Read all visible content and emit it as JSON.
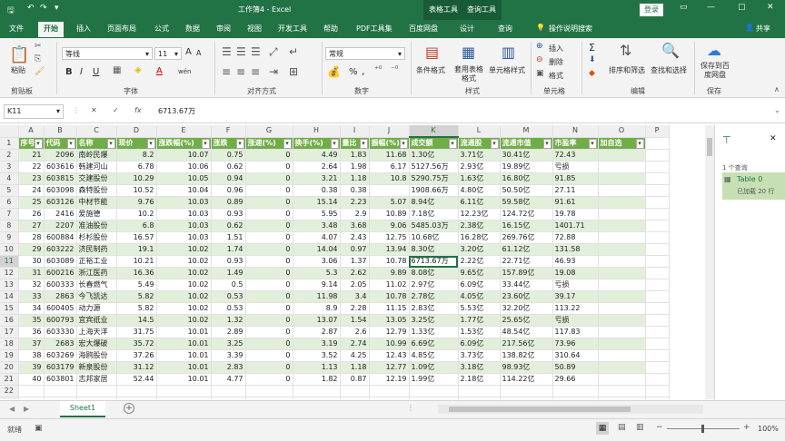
{
  "titlebar": {
    "title": "工作簿4 - Excel",
    "ctx_table": "表格工具",
    "ctx_query": "查询工具",
    "login": "登录",
    "minimize": "—",
    "restore": "▢",
    "close": "✕",
    "qa_save": "🖫",
    "qa_undo": "↶",
    "qa_redo": "↷",
    "qa_more": "▾"
  },
  "tabs": [
    "文件",
    "开始",
    "插入",
    "页面布局",
    "公式",
    "数据",
    "审阅",
    "视图",
    "开发工具",
    "帮助",
    "PDF工具集",
    "百度网盘",
    "设计",
    "查询"
  ],
  "tell_me": "操作说明搜索",
  "share": "共享",
  "ribbon": {
    "paste": "粘贴",
    "clipboard": "剪贴板",
    "font_name": "等线",
    "font_size": "11",
    "font_group": "字体",
    "bold": "B",
    "italic": "I",
    "underline": "U",
    "grow": "A",
    "shrink": "A",
    "font_color": "A",
    "wen": "wén",
    "align_group": "对齐方式",
    "number_format": "常规",
    "number_group": "数字",
    "pct": "%",
    "comma": ",",
    "cond_format": "条件格式",
    "table_format": "套用表格格式",
    "cell_styles": "单元格样式",
    "style_group": "样式",
    "insert": "插入",
    "delete": "删除",
    "format": "格式",
    "cells_group": "单元格",
    "sort_filter": "排序和筛选",
    "find_select": "查找和选择",
    "edit_group": "编辑",
    "save_baidu": "保存到百度网盘",
    "save_group": "保存"
  },
  "formula": {
    "name_box": "K11",
    "cancel": "✕",
    "confirm": "✓",
    "fx": "fx",
    "value": "6713.67万"
  },
  "columns": [
    "A",
    "B",
    "C",
    "D",
    "E",
    "F",
    "G",
    "H",
    "I",
    "J",
    "K",
    "L",
    "M",
    "N",
    "O",
    "P"
  ],
  "header_row": [
    "序号",
    "代码",
    "名称",
    "现价",
    "涨跌幅(%)",
    "涨跌",
    "涨速(%)",
    "换手(%)",
    "量比",
    "振幅(%)",
    "成交额",
    "流通股",
    "流通市值",
    "市盈率",
    "加自选"
  ],
  "rows": [
    [
      "21",
      "2096",
      "南岭民爆",
      "8.2",
      "10.07",
      "0.75",
      "0",
      "4.49",
      "1.83",
      "11.68",
      "1.30亿",
      "3.71亿",
      "30.41亿",
      "72.43",
      ""
    ],
    [
      "22",
      "603616",
      "韩建河山",
      "6.78",
      "10.06",
      "0.62",
      "0",
      "2.64",
      "1.98",
      "6.17",
      "5127.56万",
      "2.93亿",
      "19.89亿",
      "亏损",
      ""
    ],
    [
      "23",
      "603815",
      "交建股份",
      "10.29",
      "10.05",
      "0.94",
      "0",
      "3.21",
      "1.18",
      "10.8",
      "5290.75万",
      "1.63亿",
      "16.80亿",
      "91.85",
      ""
    ],
    [
      "24",
      "603098",
      "森特股份",
      "10.52",
      "10.04",
      "0.96",
      "0",
      "0.38",
      "0.38",
      "",
      "1908.66万",
      "4.80亿",
      "50.50亿",
      "27.11",
      ""
    ],
    [
      "25",
      "603126",
      "中材节能",
      "9.76",
      "10.03",
      "0.89",
      "0",
      "15.14",
      "2.23",
      "5.07",
      "8.94亿",
      "6.11亿",
      "59.58亿",
      "91.61",
      ""
    ],
    [
      "26",
      "2416",
      "爱施德",
      "10.2",
      "10.03",
      "0.93",
      "0",
      "5.95",
      "2.9",
      "10.89",
      "7.18亿",
      "12.23亿",
      "124.72亿",
      "19.78",
      ""
    ],
    [
      "27",
      "2207",
      "准油股份",
      "6.8",
      "10.03",
      "0.62",
      "0",
      "3.48",
      "3.68",
      "9.06",
      "5485.03万",
      "2.38亿",
      "16.15亿",
      "1401.71",
      ""
    ],
    [
      "28",
      "600884",
      "杉杉股份",
      "16.57",
      "10.03",
      "1.51",
      "0",
      "4.07",
      "2.43",
      "12.75",
      "10.68亿",
      "16.28亿",
      "269.76亿",
      "72.88",
      ""
    ],
    [
      "29",
      "603222",
      "济民制药",
      "19.1",
      "10.02",
      "1.74",
      "0",
      "14.04",
      "0.97",
      "13.94",
      "8.30亿",
      "3.20亿",
      "61.12亿",
      "131.58",
      ""
    ],
    [
      "30",
      "603089",
      "正裕工业",
      "10.21",
      "10.02",
      "0.93",
      "0",
      "3.06",
      "1.37",
      "10.78",
      "6713.67万",
      "2.22亿",
      "22.71亿",
      "46.93",
      ""
    ],
    [
      "31",
      "600216",
      "浙江医药",
      "16.36",
      "10.02",
      "1.49",
      "0",
      "5.3",
      "2.62",
      "9.89",
      "8.08亿",
      "9.65亿",
      "157.89亿",
      "19.08",
      ""
    ],
    [
      "32",
      "600333",
      "长春燃气",
      "5.49",
      "10.02",
      "0.5",
      "0",
      "9.14",
      "2.05",
      "11.02",
      "2.97亿",
      "6.09亿",
      "33.44亿",
      "亏损",
      ""
    ],
    [
      "33",
      "2863",
      "今飞凯达",
      "5.82",
      "10.02",
      "0.53",
      "0",
      "11.98",
      "3.4",
      "10.78",
      "2.78亿",
      "4.05亿",
      "23.60亿",
      "39.17",
      ""
    ],
    [
      "34",
      "600405",
      "动力源",
      "5.82",
      "10.02",
      "0.53",
      "0",
      "8.9",
      "2.28",
      "11.15",
      "2.83亿",
      "5.53亿",
      "32.20亿",
      "113.22",
      ""
    ],
    [
      "35",
      "600793",
      "宜宾纸业",
      "14.5",
      "10.02",
      "1.32",
      "0",
      "13.07",
      "1.54",
      "13.05",
      "3.25亿",
      "1.77亿",
      "25.65亿",
      "亏损",
      ""
    ],
    [
      "36",
      "603330",
      "上海天洋",
      "31.75",
      "10.01",
      "2.89",
      "0",
      "2.87",
      "2.6",
      "12.79",
      "1.33亿",
      "1.53亿",
      "48.54亿",
      "117.83",
      ""
    ],
    [
      "37",
      "2683",
      "宏大爆破",
      "35.72",
      "10.01",
      "3.25",
      "0",
      "3.19",
      "2.74",
      "10.99",
      "6.69亿",
      "6.09亿",
      "217.56亿",
      "73.96",
      ""
    ],
    [
      "38",
      "603269",
      "海鸥股份",
      "37.26",
      "10.01",
      "3.39",
      "0",
      "3.52",
      "4.25",
      "12.43",
      "4.85亿",
      "3.73亿",
      "138.82亿",
      "310.64",
      ""
    ],
    [
      "39",
      "603179",
      "新泉股份",
      "31.12",
      "10.01",
      "2.83",
      "0",
      "1.13",
      "1.18",
      "12.77",
      "1.09亿",
      "3.18亿",
      "98.93亿",
      "50.89",
      ""
    ],
    [
      "40",
      "603801",
      "志邦家居",
      "52.44",
      "10.01",
      "4.77",
      "0",
      "1.82",
      "0.87",
      "12.19",
      "1.99亿",
      "2.18亿",
      "114.22亿",
      "29.66",
      ""
    ]
  ],
  "pane": {
    "query_count": "1 个查询",
    "table_name": "Table 0",
    "loaded": "已加载 20 行"
  },
  "sheet": {
    "name": "Sheet1",
    "add": "+"
  },
  "status": {
    "ready": "就绪",
    "zoom": "100%"
  },
  "colors": {
    "excel_green": "#217346",
    "header_green": "#70ad47",
    "band_green": "#e2efda"
  }
}
